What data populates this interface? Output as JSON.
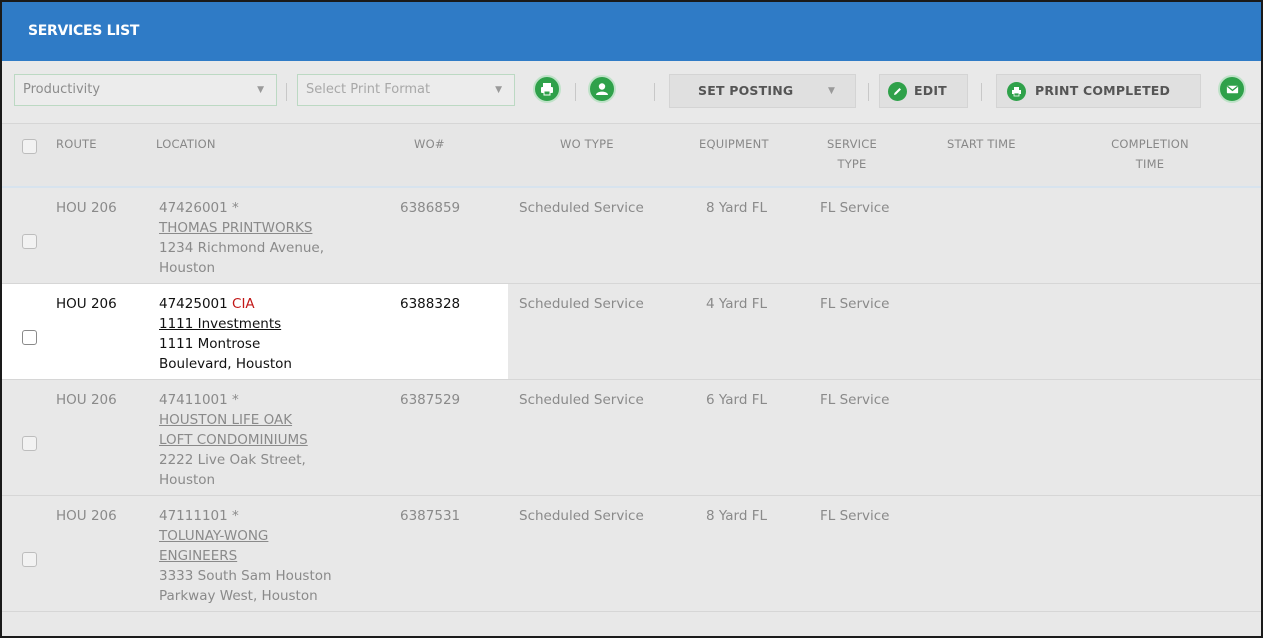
{
  "title": "SERVICES LIST",
  "toolbar": {
    "view_select": "Productivity",
    "print_format_placeholder": "Select Print Format",
    "set_posting_label": "SET POSTING",
    "edit_label": "EDIT",
    "print_completed_label": "PRINT COMPLETED",
    "icons": [
      "print-icon",
      "user-icon",
      "edit-icon",
      "print-icon",
      "email-icon"
    ]
  },
  "columns": {
    "route": "ROUTE",
    "location": "LOCATION",
    "wo": "WO#",
    "wo_type": "WO TYPE",
    "equipment": "EQUIPMENT",
    "service_type_1": "SERVICE",
    "service_type_2": "TYPE",
    "start_time": "START TIME",
    "completion_time_1": "COMPLETION",
    "completion_time_2": "TIME"
  },
  "rows": [
    {
      "route": "HOU 206",
      "account": "47426001",
      "tag": "*",
      "name_lines": [
        "THOMAS PRINTWORKS"
      ],
      "address_lines": [
        "1234 Richmond Avenue,",
        "Houston"
      ],
      "wo": "6386859",
      "wo_type": "Scheduled Service",
      "equipment": "8 Yard FL",
      "service_type": "FL Service"
    },
    {
      "route": "HOU 206",
      "account": "47425001",
      "tag": "CIA",
      "name_lines": [
        "1111 Investments"
      ],
      "address_lines": [
        "1111 Montrose",
        "Boulevard, Houston"
      ],
      "wo": "6388328",
      "wo_type": "Scheduled Service",
      "equipment": "4 Yard FL",
      "service_type": "FL Service"
    },
    {
      "route": "HOU 206",
      "account": "47411001",
      "tag": "*",
      "name_lines": [
        "HOUSTON LIFE OAK",
        "LOFT CONDOMINIUMS"
      ],
      "address_lines": [
        "2222 Live Oak Street,",
        "Houston"
      ],
      "wo": "6387529",
      "wo_type": "Scheduled Service",
      "equipment": "6 Yard FL",
      "service_type": "FL Service"
    },
    {
      "route": "HOU 206",
      "account": "47111101",
      "tag": "*",
      "name_lines": [
        "TOLUNAY-WONG",
        "ENGINEERS"
      ],
      "address_lines": [
        "3333 South Sam Houston",
        "Parkway West, Houston"
      ],
      "wo": "6387531",
      "wo_type": "Scheduled Service",
      "equipment": "8 Yard FL",
      "service_type": "FL Service"
    }
  ],
  "colors": {
    "header_blue": "#2f7bc6",
    "action_green": "#2fa14a",
    "tag_red": "#c21818"
  }
}
